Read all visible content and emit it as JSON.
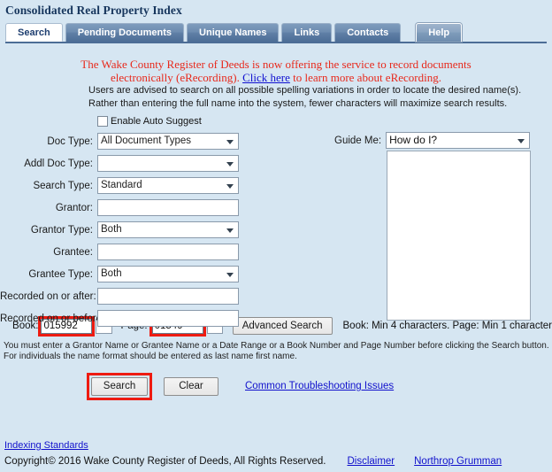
{
  "app": {
    "title": "Consolidated Real Property Index"
  },
  "tabs": [
    {
      "label": "Search",
      "active": true
    },
    {
      "label": "Pending Documents",
      "active": false
    },
    {
      "label": "Unique Names",
      "active": false
    },
    {
      "label": "Links",
      "active": false
    },
    {
      "label": "Contacts",
      "active": false
    },
    {
      "label": "Help",
      "active": false
    }
  ],
  "notice": {
    "line1": "The Wake County Register of Deeds is now offering the service to record documents",
    "line2_before": "electronically (eRecording). ",
    "link": "Click here",
    "line2_after": " to learn more about eRecording."
  },
  "advisory": {
    "line1": "Users are advised to search on all possible spelling variations in order to locate the desired name(s).",
    "line2": "Rather than entering the full name into the system, fewer characters will maximize search results."
  },
  "auto_suggest": {
    "label": "Enable Auto Suggest",
    "checked": false
  },
  "form": {
    "fields": [
      {
        "label": "Doc Type:",
        "type": "select",
        "value": "All Document Types"
      },
      {
        "label": "Addl Doc Type:",
        "type": "select",
        "value": ""
      },
      {
        "label": "Search Type:",
        "type": "select",
        "value": "Standard"
      },
      {
        "label": "Grantor:",
        "type": "text",
        "value": ""
      },
      {
        "label": "Grantor Type:",
        "type": "select",
        "value": "Both"
      },
      {
        "label": "Grantee:",
        "type": "text",
        "value": ""
      },
      {
        "label": "Grantee Type:",
        "type": "select",
        "value": "Both"
      },
      {
        "label": "Recorded on or after:",
        "type": "text",
        "value": ""
      },
      {
        "label": "Recorded on or before:",
        "type": "text",
        "value": ""
      }
    ]
  },
  "guide": {
    "label": "Guide Me:",
    "selected": "How do I?",
    "text": ""
  },
  "book_page": {
    "book_label": "Book:",
    "book_value": "015992",
    "book_secondary": "",
    "page_label": "Page:",
    "page_value": "01549",
    "page_secondary": "",
    "advanced_search_label": "Advanced Search",
    "hint": "Book: Min 4 characters. Page: Min 1 character"
  },
  "requirements": {
    "line1": "You must enter a Grantor Name or Grantee Name or a Date Range or a Book Number and Page Number before clicking the Search button.",
    "line2": "For individuals the name format should be entered as last name first name."
  },
  "actions": {
    "search_label": "Search",
    "clear_label": "Clear",
    "troubleshooting_link": "Common Troubleshooting Issues"
  },
  "footer": {
    "indexing_standards": "Indexing Standards",
    "copyright": "Copyright© 2016 Wake County Register of Deeds, All Rights Reserved.",
    "disclaimer": "Disclaimer",
    "vendor": "Northrop Grumman"
  },
  "colors": {
    "page_background": "#d6e6f2",
    "title_text": "#17365d",
    "tab_active_text": "#1f3f70",
    "tab_inactive_bg": "#5f7fa6",
    "notice_red": "#e8291c",
    "link_blue": "#1111cc",
    "highlight_red": "#ee1b11"
  }
}
